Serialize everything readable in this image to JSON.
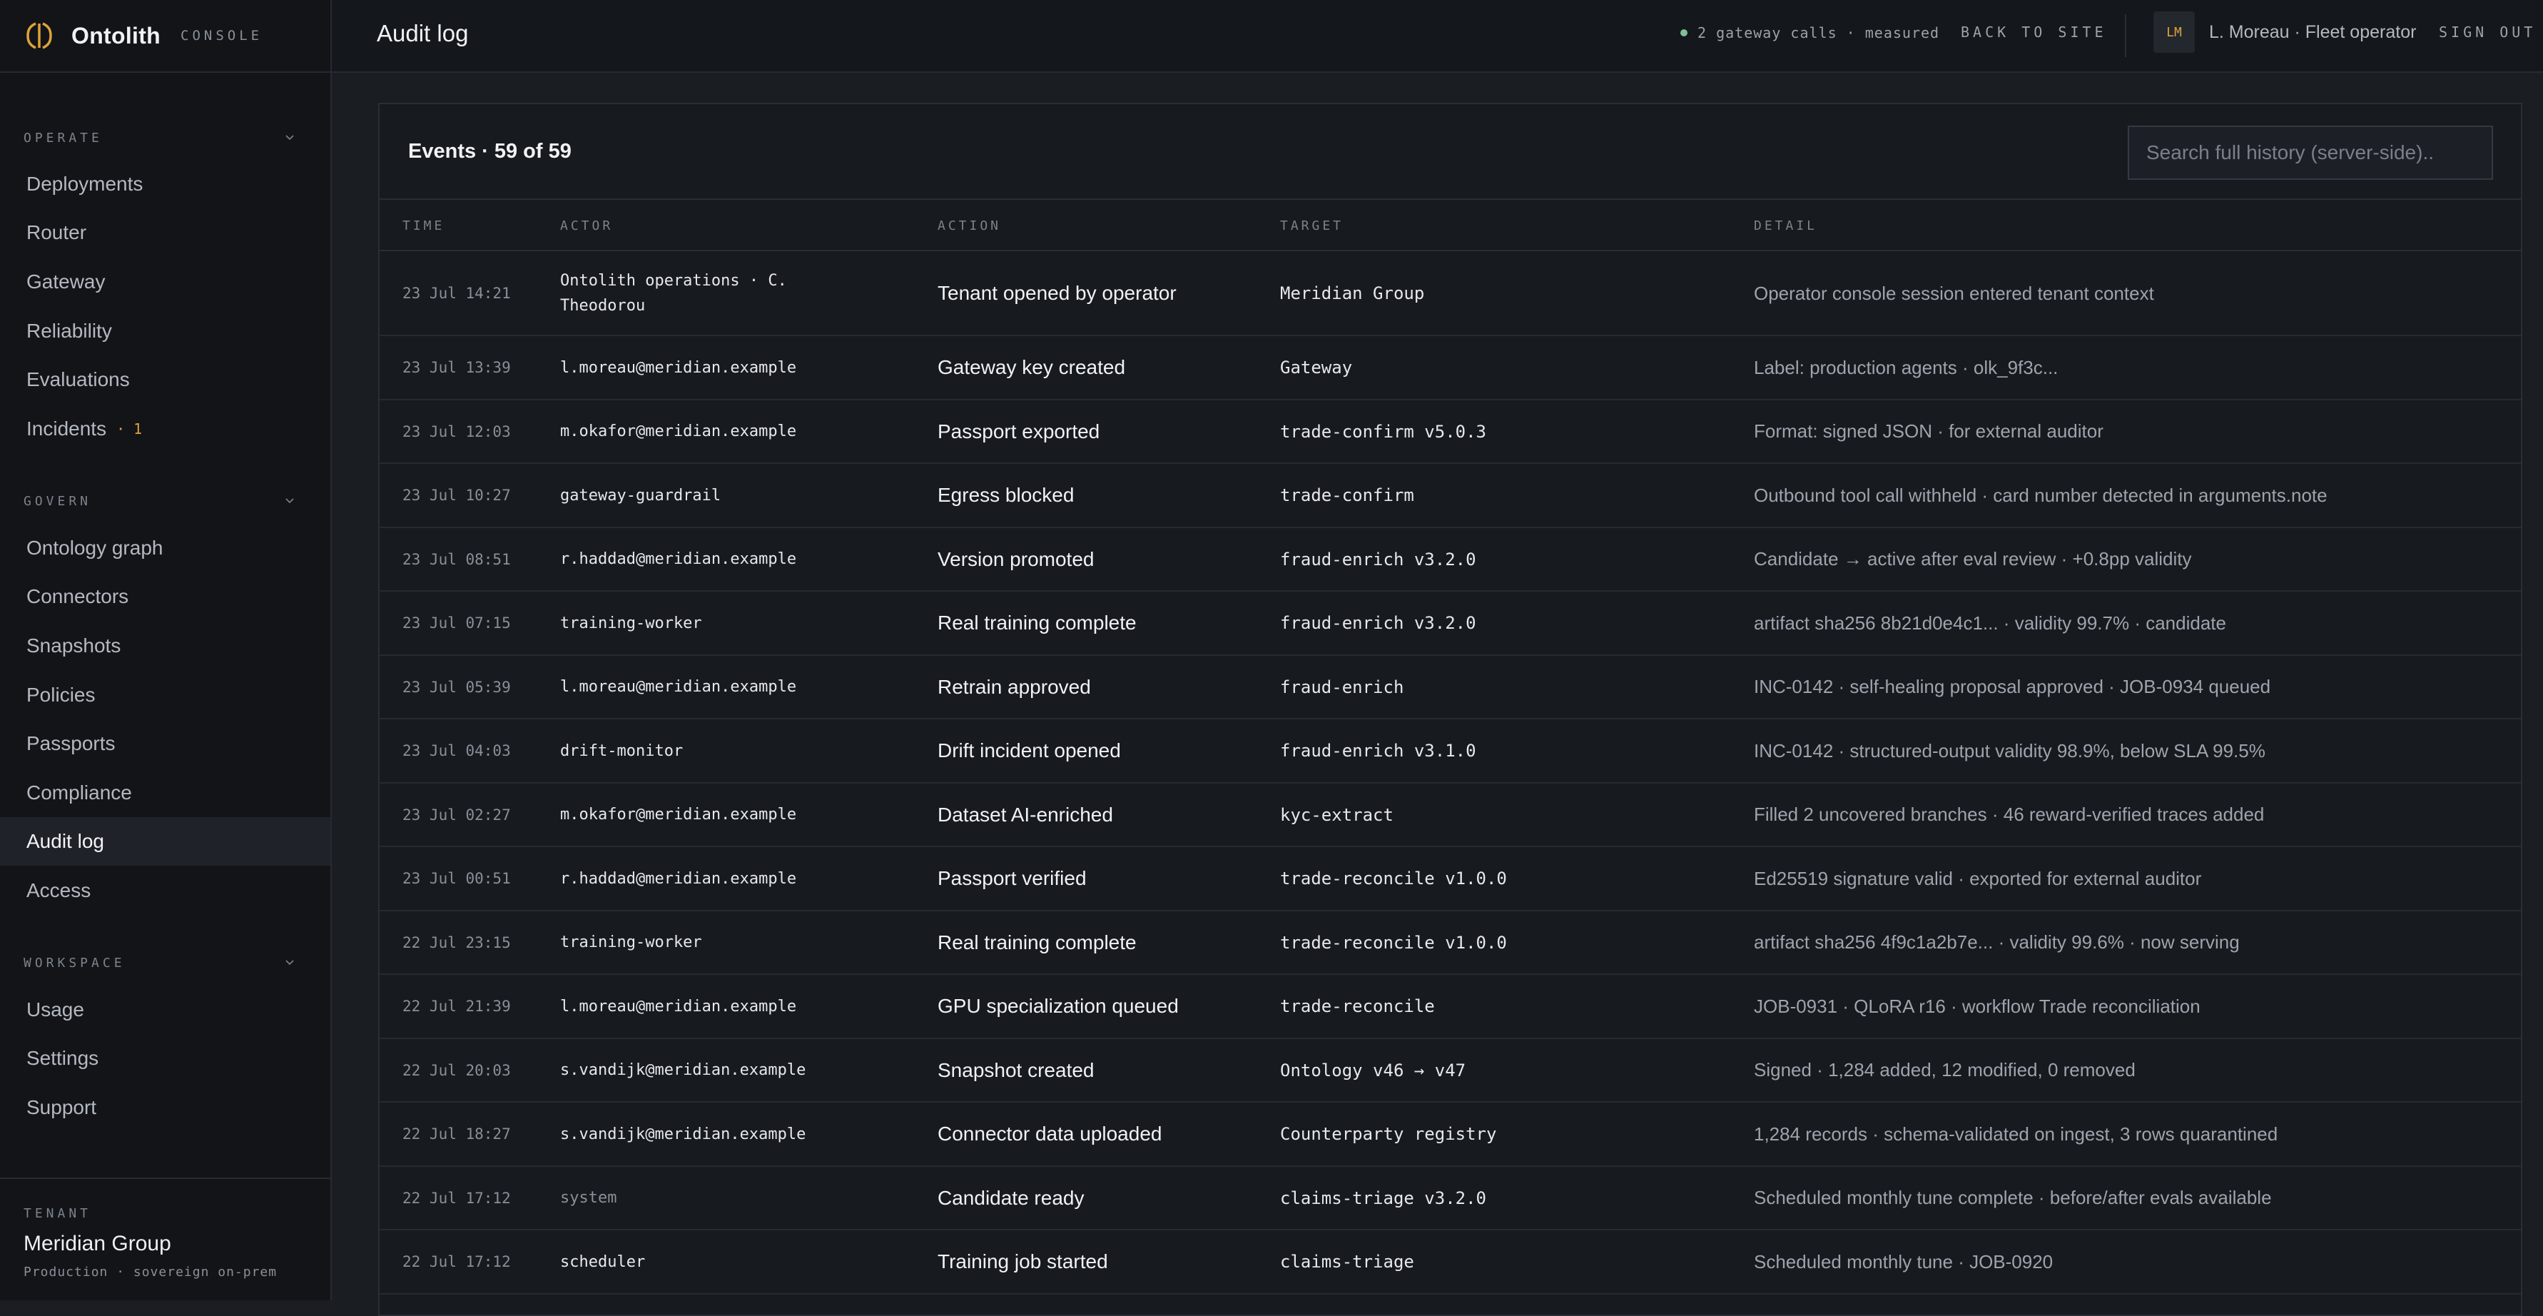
{
  "brand": {
    "name": "Ontolith",
    "tag": "CONSOLE"
  },
  "sidebar": {
    "groups": [
      {
        "label": "OPERATE",
        "items": [
          {
            "label": "Deployments"
          },
          {
            "label": "Router"
          },
          {
            "label": "Gateway"
          },
          {
            "label": "Reliability"
          },
          {
            "label": "Evaluations"
          },
          {
            "label": "Incidents",
            "badge": "· 1"
          }
        ]
      },
      {
        "label": "GOVERN",
        "items": [
          {
            "label": "Ontology graph"
          },
          {
            "label": "Connectors"
          },
          {
            "label": "Snapshots"
          },
          {
            "label": "Policies"
          },
          {
            "label": "Passports"
          },
          {
            "label": "Compliance"
          },
          {
            "label": "Audit log",
            "active": true
          },
          {
            "label": "Access"
          }
        ]
      },
      {
        "label": "WORKSPACE",
        "items": [
          {
            "label": "Usage"
          },
          {
            "label": "Settings"
          },
          {
            "label": "Support"
          }
        ]
      }
    ],
    "tenant": {
      "label": "TENANT",
      "name": "Meridian Group",
      "sub": "Production · sovereign on-prem"
    }
  },
  "header": {
    "title": "Audit log",
    "gateway_status": "2 gateway calls · measured",
    "back_link": "BACK TO SITE",
    "avatar_initials": "LM",
    "user": "L. Moreau · Fleet operator",
    "sign_out": "SIGN OUT"
  },
  "colors": {
    "accent": "#e0a23a",
    "status_ok": "#7fbf9a"
  },
  "table": {
    "title": "Events · 59 of 59",
    "search_placeholder": "Search full history (server-side)..",
    "columns": [
      "TIME",
      "ACTOR",
      "ACTION",
      "TARGET",
      "DETAIL"
    ],
    "rows": [
      {
        "time": "23 Jul 14:21",
        "actor": "Ontolith operations · C. Theodorou",
        "action": "Tenant opened by operator",
        "target": "Meridian Group",
        "detail": "Operator console session entered tenant context"
      },
      {
        "time": "23 Jul 13:39",
        "actor": "l.moreau@meridian.example",
        "action": "Gateway key created",
        "target": "Gateway",
        "detail": "Label: production agents · olk_9f3c..."
      },
      {
        "time": "23 Jul 12:03",
        "actor": "m.okafor@meridian.example",
        "action": "Passport exported",
        "target": "trade-confirm v5.0.3",
        "detail": "Format: signed JSON · for external auditor"
      },
      {
        "time": "23 Jul 10:27",
        "actor": "gateway-guardrail",
        "action": "Egress blocked",
        "target": "trade-confirm",
        "detail": "Outbound tool call withheld · card number detected in arguments.note"
      },
      {
        "time": "23 Jul 08:51",
        "actor": "r.haddad@meridian.example",
        "action": "Version promoted",
        "target": "fraud-enrich v3.2.0",
        "detail": "Candidate → active after eval review · +0.8pp validity"
      },
      {
        "time": "23 Jul 07:15",
        "actor": "training-worker",
        "action": "Real training complete",
        "target": "fraud-enrich v3.2.0",
        "detail": "artifact sha256 8b21d0e4c1... · validity 99.7% · candidate"
      },
      {
        "time": "23 Jul 05:39",
        "actor": "l.moreau@meridian.example",
        "action": "Retrain approved",
        "target": "fraud-enrich",
        "detail": "INC-0142 · self-healing proposal approved · JOB-0934 queued"
      },
      {
        "time": "23 Jul 04:03",
        "actor": "drift-monitor",
        "action": "Drift incident opened",
        "target": "fraud-enrich v3.1.0",
        "detail": "INC-0142 · structured-output validity 98.9%, below SLA 99.5%"
      },
      {
        "time": "23 Jul 02:27",
        "actor": "m.okafor@meridian.example",
        "action": "Dataset AI-enriched",
        "target": "kyc-extract",
        "detail": "Filled 2 uncovered branches · 46 reward-verified traces added"
      },
      {
        "time": "23 Jul 00:51",
        "actor": "r.haddad@meridian.example",
        "action": "Passport verified",
        "target": "trade-reconcile v1.0.0",
        "detail": "Ed25519 signature valid · exported for external auditor"
      },
      {
        "time": "22 Jul 23:15",
        "actor": "training-worker",
        "action": "Real training complete",
        "target": "trade-reconcile v1.0.0",
        "detail": "artifact sha256 4f9c1a2b7e... · validity 99.6% · now serving"
      },
      {
        "time": "22 Jul 21:39",
        "actor": "l.moreau@meridian.example",
        "action": "GPU specialization queued",
        "target": "trade-reconcile",
        "detail": "JOB-0931 · QLoRA r16 · workflow Trade reconciliation"
      },
      {
        "time": "22 Jul 20:03",
        "actor": "s.vandijk@meridian.example",
        "action": "Snapshot created",
        "target": "Ontology v46 → v47",
        "detail": "Signed · 1,284 added, 12 modified, 0 removed"
      },
      {
        "time": "22 Jul 18:27",
        "actor": "s.vandijk@meridian.example",
        "action": "Connector data uploaded",
        "target": "Counterparty registry",
        "detail": "1,284 records · schema-validated on ingest, 3 rows quarantined"
      },
      {
        "time": "22 Jul 17:12",
        "actor": "system",
        "action": "Candidate ready",
        "target": "claims-triage v3.2.0",
        "detail": "Scheduled monthly tune complete · before/after evals available",
        "actor_dim": true
      },
      {
        "time": "22 Jul 17:12",
        "actor": "scheduler",
        "action": "Training job started",
        "target": "claims-triage",
        "detail": "Scheduled monthly tune · JOB-0920"
      }
    ]
  }
}
